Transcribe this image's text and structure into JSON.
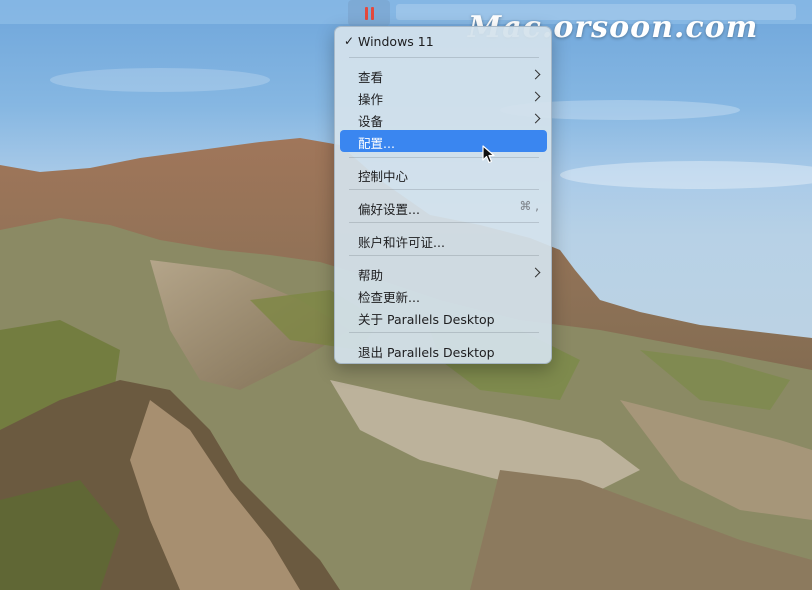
{
  "watermark": "Mac.orsoon.com",
  "menubar": {
    "app_icon": "parallels-pause-icon"
  },
  "menu": {
    "vm_item": {
      "check": "✓",
      "label": "Windows 11"
    },
    "view": "查看",
    "actions": "操作",
    "devices": "设备",
    "configure": "配置...",
    "control_center": "控制中心",
    "preferences": "偏好设置...",
    "preferences_shortcut": "⌘ ,",
    "account": "账户和许可证...",
    "help": "帮助",
    "check_updates": "检查更新...",
    "about": "关于 Parallels Desktop",
    "quit": "退出 Parallels Desktop"
  },
  "colors": {
    "selection": "#3a86f0",
    "pause_icon": "#e5483c",
    "menu_background": "#d4e2ec"
  }
}
